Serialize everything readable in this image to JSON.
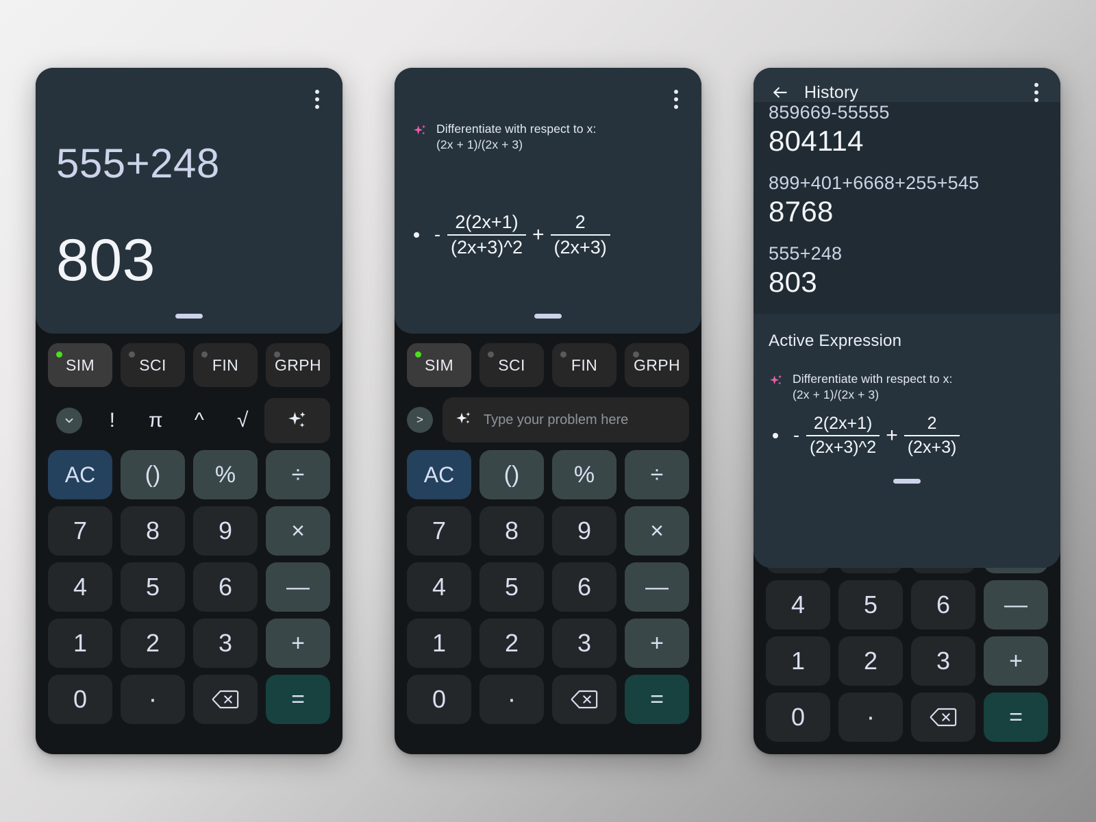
{
  "app": {
    "theme_bg_card": "#26333c",
    "theme_bg_phone": "#131619",
    "accent_ac": "#24415e",
    "accent_equals": "#17423f",
    "accent_operator": "#3a4749",
    "accent_active_dot": "#4cdf21",
    "accent_sparkle": "#e85fa8"
  },
  "panel1": {
    "display": {
      "expression": "555+248",
      "result": "803"
    },
    "kebab": "more-options"
  },
  "panel2": {
    "ai": {
      "prompt_line1": "Differentiate with respect to x:",
      "prompt_line2": "(2x + 1)/(2x + 3)",
      "answer": {
        "leading_sign": "-",
        "term1": {
          "numerator": "2(2x+1)",
          "denominator": "(2x+3)^2"
        },
        "operator": "+",
        "term2": {
          "numerator": "2",
          "denominator": "(2x+3)"
        }
      }
    },
    "input": {
      "placeholder": "Type your problem here",
      "value": "",
      "send_label": ">"
    }
  },
  "panel3": {
    "header": {
      "title": "History"
    },
    "history": [
      {
        "expression": "859669-55555",
        "result": "804114"
      },
      {
        "expression": "899+401+6668+255+545",
        "result": "8768"
      },
      {
        "expression": "555+248",
        "result": "803"
      }
    ],
    "active": {
      "title": "Active Expression",
      "prompt_line1": "Differentiate with respect to x:",
      "prompt_line2": "(2x + 1)/(2x + 3)",
      "answer": {
        "leading_sign": "-",
        "term1": {
          "numerator": "2(2x+1)",
          "denominator": "(2x+3)^2"
        },
        "operator": "+",
        "term2": {
          "numerator": "2",
          "denominator": "(2x+3)"
        }
      }
    }
  },
  "modes": [
    {
      "label": "SIM",
      "active": true
    },
    {
      "label": "SCI",
      "active": false
    },
    {
      "label": "FIN",
      "active": false
    },
    {
      "label": "GRPH",
      "active": false
    }
  ],
  "functions": [
    {
      "label": "!",
      "name": "factorial"
    },
    {
      "label": "π",
      "name": "pi"
    },
    {
      "label": "^",
      "name": "power"
    },
    {
      "label": "√",
      "name": "square-root"
    }
  ],
  "keypad": {
    "row1": [
      {
        "label": "AC",
        "kind": "ac",
        "name": "all-clear"
      },
      {
        "label": "()",
        "kind": "op",
        "name": "parentheses"
      },
      {
        "label": "%",
        "kind": "op",
        "name": "percent"
      },
      {
        "label": "÷",
        "kind": "op",
        "name": "divide"
      }
    ],
    "row2": [
      {
        "label": "7",
        "kind": "digit",
        "name": "digit-7"
      },
      {
        "label": "8",
        "kind": "digit",
        "name": "digit-8"
      },
      {
        "label": "9",
        "kind": "digit",
        "name": "digit-9"
      },
      {
        "label": "×",
        "kind": "op",
        "name": "multiply"
      }
    ],
    "row3": [
      {
        "label": "4",
        "kind": "digit",
        "name": "digit-4"
      },
      {
        "label": "5",
        "kind": "digit",
        "name": "digit-5"
      },
      {
        "label": "6",
        "kind": "digit",
        "name": "digit-6"
      },
      {
        "label": "—",
        "kind": "op",
        "name": "subtract"
      }
    ],
    "row4": [
      {
        "label": "1",
        "kind": "digit",
        "name": "digit-1"
      },
      {
        "label": "2",
        "kind": "digit",
        "name": "digit-2"
      },
      {
        "label": "3",
        "kind": "digit",
        "name": "digit-3"
      },
      {
        "label": "+",
        "kind": "op",
        "name": "add"
      }
    ],
    "row5": [
      {
        "label": "0",
        "kind": "digit",
        "name": "digit-0"
      },
      {
        "label": "·",
        "kind": "dot",
        "name": "decimal-point"
      },
      {
        "label": "",
        "kind": "backspace",
        "name": "backspace"
      },
      {
        "label": "=",
        "kind": "eq",
        "name": "equals"
      }
    ]
  }
}
